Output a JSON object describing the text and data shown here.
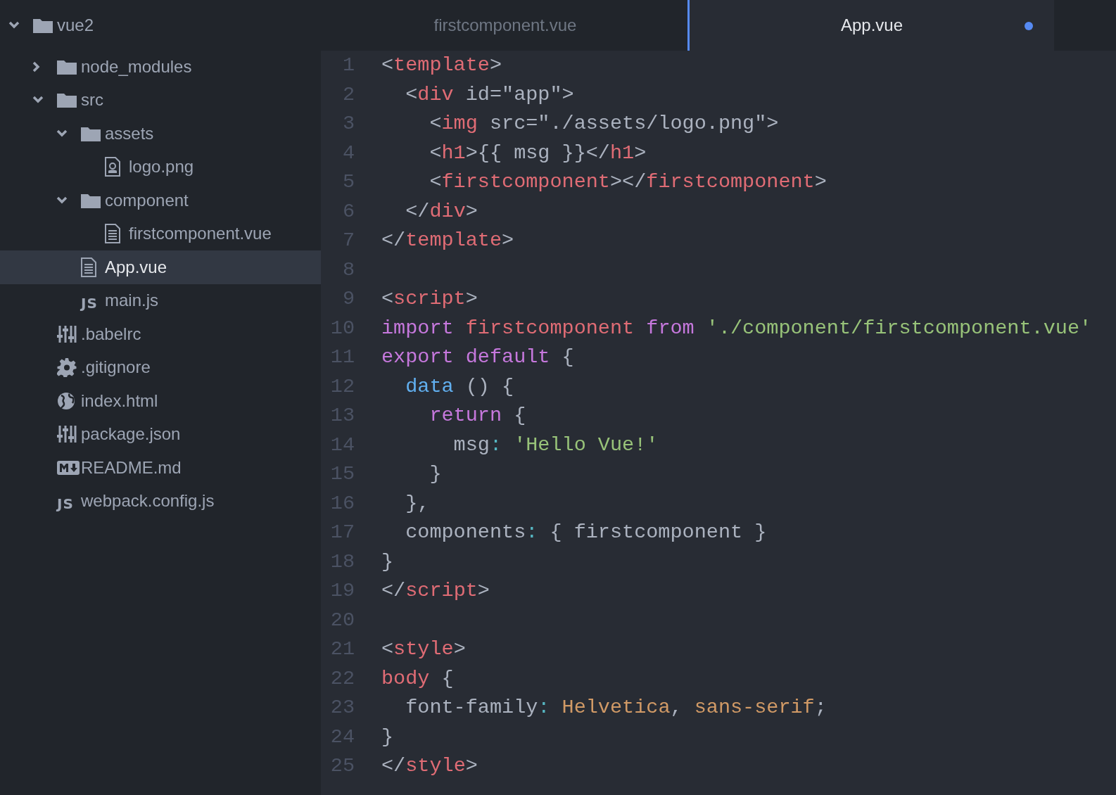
{
  "tree": [
    {
      "name": "vue2",
      "kind": "folder",
      "expanded": true,
      "selected": false,
      "children": [
        {
          "name": "node_modules",
          "kind": "folder",
          "expanded": false,
          "selected": false
        },
        {
          "name": "src",
          "kind": "folder",
          "expanded": true,
          "selected": false,
          "children": [
            {
              "name": "assets",
              "kind": "folder",
              "expanded": true,
              "selected": false,
              "children": [
                {
                  "name": "logo.png",
                  "kind": "image",
                  "selected": false
                }
              ]
            },
            {
              "name": "component",
              "kind": "folder",
              "expanded": true,
              "selected": false,
              "children": [
                {
                  "name": "firstcomponent.vue",
                  "kind": "file",
                  "selected": false
                }
              ]
            },
            {
              "name": "App.vue",
              "kind": "file",
              "selected": true
            },
            {
              "name": "main.js",
              "kind": "js",
              "icon_text": "JS",
              "selected": false
            }
          ]
        },
        {
          "name": ".babelrc",
          "kind": "config",
          "selected": false
        },
        {
          "name": ".gitignore",
          "kind": "gear",
          "selected": false
        },
        {
          "name": "index.html",
          "kind": "globe",
          "selected": false
        },
        {
          "name": "package.json",
          "kind": "config",
          "selected": false
        },
        {
          "name": "README.md",
          "kind": "markdown",
          "selected": false
        },
        {
          "name": "webpack.config.js",
          "kind": "js",
          "icon_text": "JS",
          "selected": false
        }
      ]
    }
  ],
  "tabs": [
    {
      "label": "firstcomponent.vue",
      "selected": false,
      "modified": false
    },
    {
      "label": "App.vue",
      "selected": true,
      "modified": true
    }
  ],
  "editor": {
    "lines": [
      {
        "number": "1",
        "tokens": [
          {
            "kind": "punct",
            "text": "<"
          },
          {
            "kind": "tag",
            "text": "template"
          },
          {
            "kind": "punct",
            "text": ">"
          }
        ]
      },
      {
        "number": "2",
        "tokens": [
          {
            "kind": "punct",
            "text": "  <"
          },
          {
            "kind": "tag",
            "text": "div"
          },
          {
            "kind": "punct",
            "text": " id=\"app\">"
          }
        ]
      },
      {
        "number": "3",
        "tokens": [
          {
            "kind": "punct",
            "text": "    <"
          },
          {
            "kind": "tag",
            "text": "img"
          },
          {
            "kind": "punct",
            "text": " src=\"./assets/logo.png\">"
          }
        ]
      },
      {
        "number": "4",
        "tokens": [
          {
            "kind": "punct",
            "text": "    <"
          },
          {
            "kind": "tag",
            "text": "h1"
          },
          {
            "kind": "punct",
            "text": ">{{ msg }}</"
          },
          {
            "kind": "tag",
            "text": "h1"
          },
          {
            "kind": "punct",
            "text": ">"
          }
        ]
      },
      {
        "number": "5",
        "tokens": [
          {
            "kind": "punct",
            "text": "    <"
          },
          {
            "kind": "tag",
            "text": "firstcomponent"
          },
          {
            "kind": "punct",
            "text": "></"
          },
          {
            "kind": "tag",
            "text": "firstcomponent"
          },
          {
            "kind": "punct",
            "text": ">"
          }
        ]
      },
      {
        "number": "6",
        "tokens": [
          {
            "kind": "punct",
            "text": "  </"
          },
          {
            "kind": "tag",
            "text": "div"
          },
          {
            "kind": "punct",
            "text": ">"
          }
        ]
      },
      {
        "number": "7",
        "tokens": [
          {
            "kind": "punct",
            "text": "</"
          },
          {
            "kind": "tag",
            "text": "template"
          },
          {
            "kind": "punct",
            "text": ">"
          }
        ]
      },
      {
        "number": "8"
      },
      {
        "number": "9",
        "tokens": [
          {
            "kind": "punct",
            "text": "<"
          },
          {
            "kind": "tag",
            "text": "script"
          },
          {
            "kind": "punct",
            "text": ">"
          }
        ]
      },
      {
        "number": "10",
        "tokens": [
          {
            "kind": "keyword",
            "text": "import "
          },
          {
            "kind": "tag",
            "text": "firstcomponent "
          },
          {
            "kind": "keyword",
            "text": "from "
          },
          {
            "kind": "string",
            "text": "'./component/firstcomponent.vue'"
          }
        ]
      },
      {
        "number": "11",
        "tokens": [
          {
            "kind": "keyword",
            "text": "export default"
          },
          {
            "kind": "punct",
            "text": " {"
          }
        ]
      },
      {
        "number": "12",
        "tokens": [
          {
            "kind": "func",
            "text": "  data"
          },
          {
            "kind": "punct",
            "text": " () {"
          }
        ]
      },
      {
        "number": "13",
        "tokens": [
          {
            "kind": "keyword",
            "text": "    return"
          },
          {
            "kind": "punct",
            "text": " {"
          }
        ]
      },
      {
        "number": "14",
        "tokens": [
          {
            "kind": "punct",
            "text": "      msg"
          },
          {
            "kind": "operator",
            "text": ":"
          },
          {
            "kind": "string",
            "text": " 'Hello Vue!'"
          }
        ]
      },
      {
        "number": "15",
        "tokens": [
          {
            "kind": "punct",
            "text": "    }"
          }
        ]
      },
      {
        "number": "16",
        "tokens": [
          {
            "kind": "punct",
            "text": "  },"
          }
        ]
      },
      {
        "number": "17",
        "tokens": [
          {
            "kind": "punct",
            "text": "  components"
          },
          {
            "kind": "operator",
            "text": ":"
          },
          {
            "kind": "punct",
            "text": " { firstcomponent }"
          }
        ]
      },
      {
        "number": "18",
        "tokens": [
          {
            "kind": "punct",
            "text": "}"
          }
        ]
      },
      {
        "number": "19",
        "tokens": [
          {
            "kind": "punct",
            "text": "</"
          },
          {
            "kind": "tag",
            "text": "script"
          },
          {
            "kind": "punct",
            "text": ">"
          }
        ]
      },
      {
        "number": "20"
      },
      {
        "number": "21",
        "tokens": [
          {
            "kind": "punct",
            "text": "<"
          },
          {
            "kind": "tag",
            "text": "style"
          },
          {
            "kind": "punct",
            "text": ">"
          }
        ]
      },
      {
        "number": "22",
        "tokens": [
          {
            "kind": "tag",
            "text": "body"
          },
          {
            "kind": "punct",
            "text": " {"
          }
        ]
      },
      {
        "number": "23",
        "tokens": [
          {
            "kind": "punct",
            "text": "  font-family"
          },
          {
            "kind": "operator",
            "text": ":"
          },
          {
            "kind": "value",
            "text": " Helvetica"
          },
          {
            "kind": "punct",
            "text": ","
          },
          {
            "kind": "value",
            "text": " sans-serif"
          },
          {
            "kind": "punct",
            "text": ";"
          }
        ]
      },
      {
        "number": "24",
        "tokens": [
          {
            "kind": "punct",
            "text": "}"
          }
        ]
      },
      {
        "number": "25",
        "tokens": [
          {
            "kind": "punct",
            "text": "</"
          },
          {
            "kind": "tag",
            "text": "style"
          },
          {
            "kind": "punct",
            "text": ">"
          }
        ]
      }
    ]
  }
}
